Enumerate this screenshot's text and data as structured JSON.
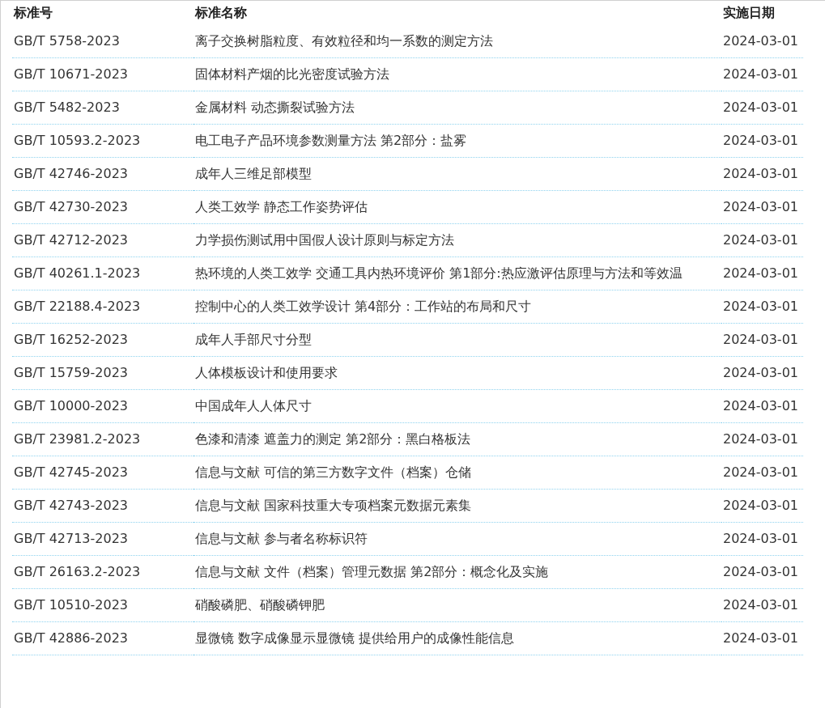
{
  "table": {
    "columns": [
      "标准号",
      "标准名称",
      "实施日期"
    ],
    "rows": [
      {
        "number": "GB/T 5758-2023",
        "name": "离子交换树脂粒度、有效粒径和均一系数的测定方法",
        "date": "2024-03-01"
      },
      {
        "number": "GB/T 10671-2023",
        "name": "固体材料产烟的比光密度试验方法",
        "date": "2024-03-01"
      },
      {
        "number": "GB/T 5482-2023",
        "name": "金属材料 动态撕裂试验方法",
        "date": "2024-03-01"
      },
      {
        "number": "GB/T 10593.2-2023",
        "name": "电工电子产品环境参数测量方法 第2部分：盐雾",
        "date": "2024-03-01"
      },
      {
        "number": "GB/T 42746-2023",
        "name": "成年人三维足部模型",
        "date": "2024-03-01"
      },
      {
        "number": "GB/T 42730-2023",
        "name": "人类工效学 静态工作姿势评估",
        "date": "2024-03-01"
      },
      {
        "number": "GB/T 42712-2023",
        "name": "力学损伤测试用中国假人设计原则与标定方法",
        "date": "2024-03-01"
      },
      {
        "number": "GB/T 40261.1-2023",
        "name": "热环境的人类工效学 交通工具内热环境评价 第1部分:热应激评估原理与方法和等效温",
        "date": "2024-03-01"
      },
      {
        "number": "GB/T 22188.4-2023",
        "name": "控制中心的人类工效学设计 第4部分：工作站的布局和尺寸",
        "date": "2024-03-01"
      },
      {
        "number": "GB/T 16252-2023",
        "name": "成年人手部尺寸分型",
        "date": "2024-03-01"
      },
      {
        "number": "GB/T 15759-2023",
        "name": "人体模板设计和使用要求",
        "date": "2024-03-01"
      },
      {
        "number": "GB/T 10000-2023",
        "name": "中国成年人人体尺寸",
        "date": "2024-03-01"
      },
      {
        "number": "GB/T 23981.2-2023",
        "name": "色漆和清漆 遮盖力的测定 第2部分：黑白格板法",
        "date": "2024-03-01"
      },
      {
        "number": "GB/T 42745-2023",
        "name": "信息与文献 可信的第三方数字文件（档案）仓储",
        "date": "2024-03-01"
      },
      {
        "number": "GB/T 42743-2023",
        "name": "信息与文献 国家科技重大专项档案元数据元素集",
        "date": "2024-03-01"
      },
      {
        "number": "GB/T 42713-2023",
        "name": "信息与文献 参与者名称标识符",
        "date": "2024-03-01"
      },
      {
        "number": "GB/T 26163.2-2023",
        "name": "信息与文献 文件（档案）管理元数据 第2部分：概念化及实施",
        "date": "2024-03-01"
      },
      {
        "number": "GB/T 10510-2023",
        "name": "硝酸磷肥、硝酸磷钾肥",
        "date": "2024-03-01"
      },
      {
        "number": "GB/T 42886-2023",
        "name": "显微镜 数字成像显示显微镜 提供给用户的成像性能信息",
        "date": "2024-03-01"
      }
    ]
  }
}
